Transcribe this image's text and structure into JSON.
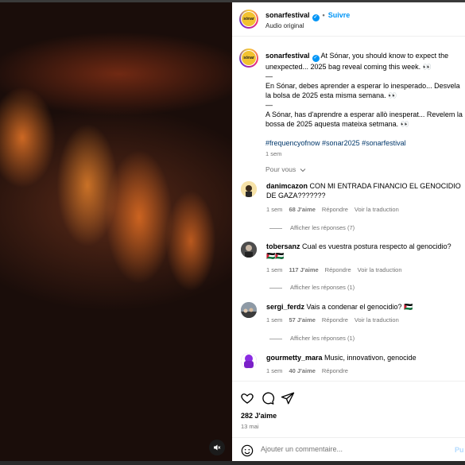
{
  "post": {
    "username": "sonarfestival",
    "follow_label": "Suivre",
    "audio": "Audio original",
    "avatar_logo": "sónar"
  },
  "caption": {
    "username": "sonarfestival",
    "line1": "At Sónar, you should know to expect the",
    "line2": "unexpected... 2025 bag reveal coming this week. 👀",
    "sep1": "—",
    "line3": "En Sónar, debes aprender a esperar lo inesperado... Desvela",
    "line4": "la bolsa de 2025 esta misma semana. 👀",
    "sep2": "—",
    "line5": "A Sónar, has d'aprendre a esperar allò inesperat... Revelem la",
    "line6": "bossa de 2025 aquesta mateixa setmana. 👀",
    "hashtags": "#frequencyofnow #sonar2025 #sonarfestival",
    "time": "1 sem"
  },
  "pour_vous": "Pour vous",
  "comments": [
    {
      "username": "danimcazon",
      "text": "CON MI ENTRADA FINANCIO EL GENOCIDIO",
      "text2": "DE GAZA???????",
      "time": "1 sem",
      "likes": "68 J'aime",
      "reply": "Répondre",
      "translate": "Voir la traduction",
      "replies": "Afficher les réponses (7)"
    },
    {
      "username": "tobersanz",
      "text": "Cual es vuestra postura respecto al genocidio?",
      "text2": "🇵🇸🇵🇸",
      "time": "1 sem",
      "likes": "117 J'aime",
      "reply": "Répondre",
      "translate": "Voir la traduction",
      "replies": "Afficher les réponses (1)"
    },
    {
      "username": "sergi_ferdz",
      "text": "Vais a condenar el genocidio? 🇵🇸",
      "time": "1 sem",
      "likes": "57 J'aime",
      "reply": "Répondre",
      "translate": "Voir la traduction",
      "replies": "Afficher les réponses (1)"
    },
    {
      "username": "gourmetty_mara",
      "text": "Music, innovativon, genocide",
      "time": "1 sem",
      "likes": "40 J'aime",
      "reply": "Répondre"
    }
  ],
  "footer": {
    "likes": "282 J'aime",
    "date": "13 mai",
    "comment_placeholder": "Ajouter un commentaire...",
    "publish": "Pu"
  },
  "colors": {
    "accent": "#0095f6",
    "muted": "#737373",
    "tag": "#00376b"
  }
}
